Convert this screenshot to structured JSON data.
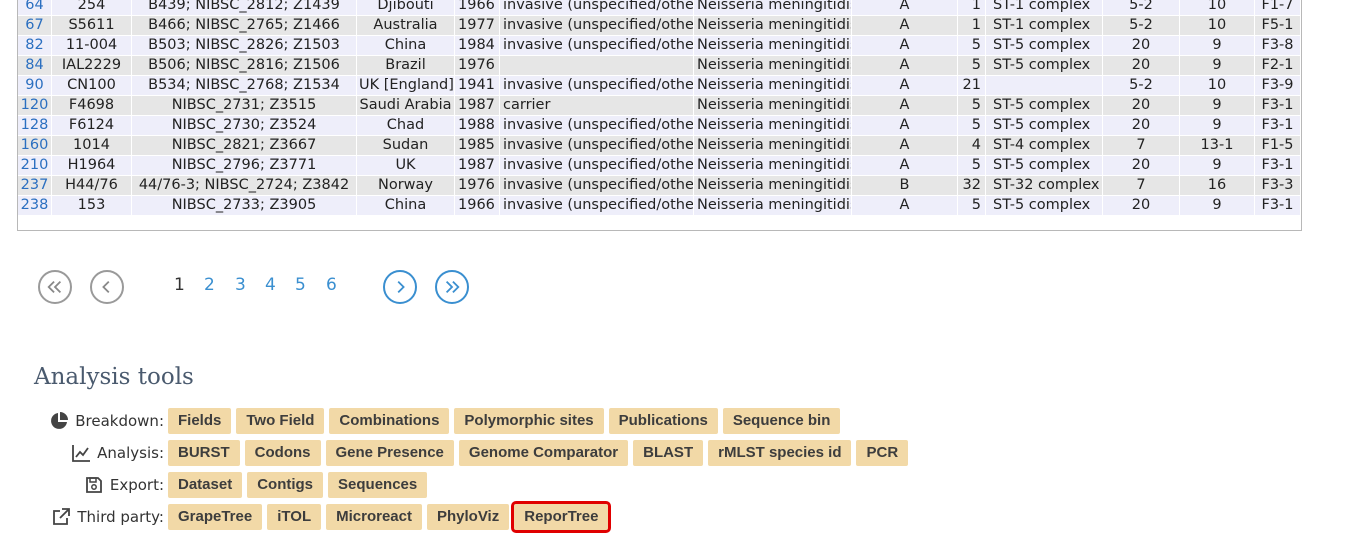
{
  "table": {
    "rows": [
      {
        "id": "64",
        "isolate": "254",
        "aliases": "B439; NIBSC_2812; Z1439",
        "country": "Djibouti",
        "year": "1966",
        "disease": "invasive (unspecified/other)",
        "species": "Neisseria meningitidis",
        "serogroup": "A",
        "st": "1",
        "cc": "ST-1 complex",
        "pora_vr1": "5-2",
        "pora_vr2": "10",
        "feta": "F1-7"
      },
      {
        "id": "67",
        "isolate": "S5611",
        "aliases": "B466; NIBSC_2765; Z1466",
        "country": "Australia",
        "year": "1977",
        "disease": "invasive (unspecified/other)",
        "species": "Neisseria meningitidis",
        "serogroup": "A",
        "st": "1",
        "cc": "ST-1 complex",
        "pora_vr1": "5-2",
        "pora_vr2": "10",
        "feta": "F5-1"
      },
      {
        "id": "82",
        "isolate": "11-004",
        "aliases": "B503; NIBSC_2826; Z1503",
        "country": "China",
        "year": "1984",
        "disease": "invasive (unspecified/other)",
        "species": "Neisseria meningitidis",
        "serogroup": "A",
        "st": "5",
        "cc": "ST-5 complex",
        "pora_vr1": "20",
        "pora_vr2": "9",
        "feta": "F3-8"
      },
      {
        "id": "84",
        "isolate": "IAL2229",
        "aliases": "B506; NIBSC_2816; Z1506",
        "country": "Brazil",
        "year": "1976",
        "disease": "",
        "species": "Neisseria meningitidis",
        "serogroup": "A",
        "st": "5",
        "cc": "ST-5 complex",
        "pora_vr1": "20",
        "pora_vr2": "9",
        "feta": "F2-1"
      },
      {
        "id": "90",
        "isolate": "CN100",
        "aliases": "B534; NIBSC_2768; Z1534",
        "country": "UK [England]",
        "year": "1941",
        "disease": "invasive (unspecified/other)",
        "species": "Neisseria meningitidis",
        "serogroup": "A",
        "st": "21",
        "cc": "",
        "pora_vr1": "5-2",
        "pora_vr2": "10",
        "feta": "F3-9"
      },
      {
        "id": "120",
        "isolate": "F4698",
        "aliases": "NIBSC_2731; Z3515",
        "country": "Saudi Arabia",
        "year": "1987",
        "disease": "carrier",
        "species": "Neisseria meningitidis",
        "serogroup": "A",
        "st": "5",
        "cc": "ST-5 complex",
        "pora_vr1": "20",
        "pora_vr2": "9",
        "feta": "F3-1"
      },
      {
        "id": "128",
        "isolate": "F6124",
        "aliases": "NIBSC_2730; Z3524",
        "country": "Chad",
        "year": "1988",
        "disease": "invasive (unspecified/other)",
        "species": "Neisseria meningitidis",
        "serogroup": "A",
        "st": "5",
        "cc": "ST-5 complex",
        "pora_vr1": "20",
        "pora_vr2": "9",
        "feta": "F3-1"
      },
      {
        "id": "160",
        "isolate": "1014",
        "aliases": "NIBSC_2821; Z3667",
        "country": "Sudan",
        "year": "1985",
        "disease": "invasive (unspecified/other)",
        "species": "Neisseria meningitidis",
        "serogroup": "A",
        "st": "4",
        "cc": "ST-4 complex",
        "pora_vr1": "7",
        "pora_vr2": "13-1",
        "feta": "F1-5"
      },
      {
        "id": "210",
        "isolate": "H1964",
        "aliases": "NIBSC_2796; Z3771",
        "country": "UK",
        "year": "1987",
        "disease": "invasive (unspecified/other)",
        "species": "Neisseria meningitidis",
        "serogroup": "A",
        "st": "5",
        "cc": "ST-5 complex",
        "pora_vr1": "20",
        "pora_vr2": "9",
        "feta": "F3-1"
      },
      {
        "id": "237",
        "isolate": "H44/76",
        "aliases": "44/76-3; NIBSC_2724; Z3842",
        "country": "Norway",
        "year": "1976",
        "disease": "invasive (unspecified/other)",
        "species": "Neisseria meningitidis",
        "serogroup": "B",
        "st": "32",
        "cc": "ST-32 complex",
        "pora_vr1": "7",
        "pora_vr2": "16",
        "feta": "F3-3"
      },
      {
        "id": "238",
        "isolate": "153",
        "aliases": "NIBSC_2733; Z3905",
        "country": "China",
        "year": "1966",
        "disease": "invasive (unspecified/other)",
        "species": "Neisseria meningitidis",
        "serogroup": "A",
        "st": "5",
        "cc": "ST-5 complex",
        "pora_vr1": "20",
        "pora_vr2": "9",
        "feta": "F3-1"
      }
    ]
  },
  "pager": {
    "pages": [
      "1",
      "2",
      "3",
      "4",
      "5",
      "6"
    ],
    "current": "1"
  },
  "analysis": {
    "title": "Analysis tools",
    "rows": [
      {
        "label": "Breakdown:",
        "icon": "pie-chart-icon",
        "buttons": [
          "Fields",
          "Two Field",
          "Combinations",
          "Polymorphic sites",
          "Publications",
          "Sequence bin"
        ]
      },
      {
        "label": "Analysis:",
        "icon": "line-chart-icon",
        "buttons": [
          "BURST",
          "Codons",
          "Gene Presence",
          "Genome Comparator",
          "BLAST",
          "rMLST species id",
          "PCR"
        ]
      },
      {
        "label": "Export:",
        "icon": "save-icon",
        "buttons": [
          "Dataset",
          "Contigs",
          "Sequences"
        ]
      },
      {
        "label": "Third party:",
        "icon": "external-link-icon",
        "buttons": [
          "GrapeTree",
          "iTOL",
          "Microreact",
          "PhyloViz",
          "ReporTree"
        ]
      }
    ],
    "highlighted_button": "ReporTree"
  },
  "colors": {
    "link": "#2b6fc0",
    "button_bg": "#f2d9a7",
    "highlight": "#e00000",
    "row_odd": "#eeeefa",
    "row_even": "#e6e6e6"
  }
}
